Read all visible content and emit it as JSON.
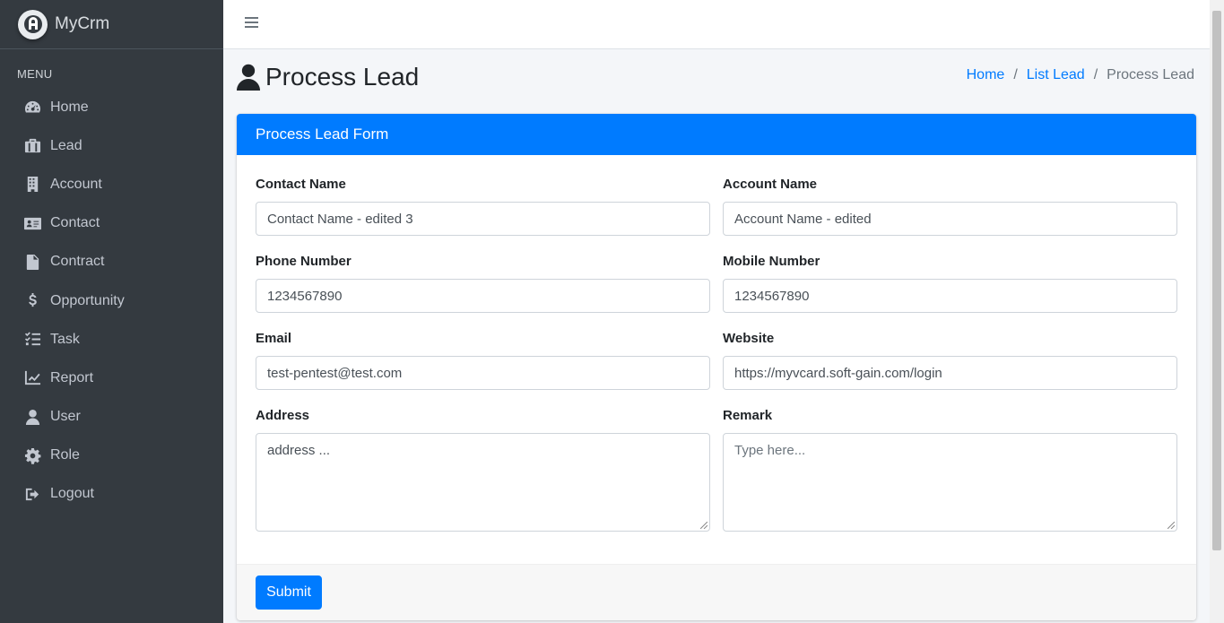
{
  "brand": {
    "name": "MyCrm",
    "logo_icon": "brand-logo-icon"
  },
  "sidebar": {
    "header": "MENU",
    "items": [
      {
        "label": "Home",
        "icon": "tachometer-icon"
      },
      {
        "label": "Lead",
        "icon": "briefcase-icon"
      },
      {
        "label": "Account",
        "icon": "building-icon"
      },
      {
        "label": "Contact",
        "icon": "address-card-icon"
      },
      {
        "label": "Contract",
        "icon": "file-contract-icon"
      },
      {
        "label": "Opportunity",
        "icon": "dollar-icon"
      },
      {
        "label": "Task",
        "icon": "tasks-icon"
      },
      {
        "label": "Report",
        "icon": "chart-line-icon"
      },
      {
        "label": "User",
        "icon": "user-icon"
      },
      {
        "label": "Role",
        "icon": "gear-icon"
      },
      {
        "label": "Logout",
        "icon": "sign-out-icon"
      }
    ]
  },
  "page": {
    "title": "Process Lead"
  },
  "breadcrumb": {
    "home": "Home",
    "list": "List Lead",
    "current": "Process Lead",
    "separator": "/"
  },
  "form": {
    "title": "Process Lead Form",
    "contact_name": {
      "label": "Contact Name",
      "value": "Contact Name - edited 3"
    },
    "account_name": {
      "label": "Account Name",
      "value": "Account Name - edited"
    },
    "phone_number": {
      "label": "Phone Number",
      "value": "1234567890"
    },
    "mobile_number": {
      "label": "Mobile Number",
      "value": "1234567890"
    },
    "email": {
      "label": "Email",
      "value": "test-pentest@test.com"
    },
    "website": {
      "label": "Website",
      "value": "https://myvcard.soft-gain.com/login"
    },
    "address": {
      "label": "Address",
      "value": "address ..."
    },
    "remark": {
      "label": "Remark",
      "value": "",
      "placeholder": "Type here..."
    },
    "submit_label": "Submit"
  },
  "colors": {
    "sidebar_bg": "#343a40",
    "primary": "#007bff",
    "content_bg": "#f4f6f9"
  }
}
